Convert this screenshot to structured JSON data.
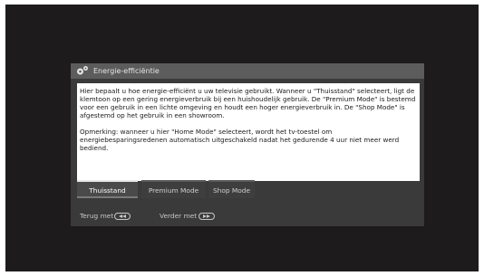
{
  "dialog": {
    "title": "Energie-efficiëntie",
    "title_icon": "gear-icon",
    "body": {
      "paragraph1": "Hier bepaalt u hoe energie-efficiënt u uw televisie gebruikt. Wanneer u \"Thuisstand\" selecteert, ligt de klemtoon op een gering energieverbruik bij een huishoudelijk gebruik. De \"Premium Mode\" is bestemd voor een gebruik in een lichte omgeving en houdt een hoger energieverbruik in. De \"Shop Mode\" is afgestemd op het gebruik in een showroom.",
      "paragraph2": "Opmerking: wanneer u hier \"Home Mode\" selecteert, wordt het tv-toestel om energiebesparingsredenen automatisch uitgeschakeld nadat het gedurende 4 uur niet meer werd bediend."
    },
    "options": [
      {
        "label": "Thuisstand",
        "selected": true
      },
      {
        "label": "Premium Mode",
        "selected": false
      },
      {
        "label": "Shop Mode",
        "selected": false
      }
    ],
    "footer": {
      "back_label": "Terug met",
      "back_icon": "rewind-key-icon",
      "next_label": "Verder met",
      "next_icon": "fast-forward-key-icon"
    }
  },
  "colors": {
    "screen_background": "#1d1b1c",
    "dialog_background": "#3a3a3a",
    "header_background": "#5c5c5c",
    "body_background": "#ffffff",
    "selected_option": "#4a4a4a"
  }
}
